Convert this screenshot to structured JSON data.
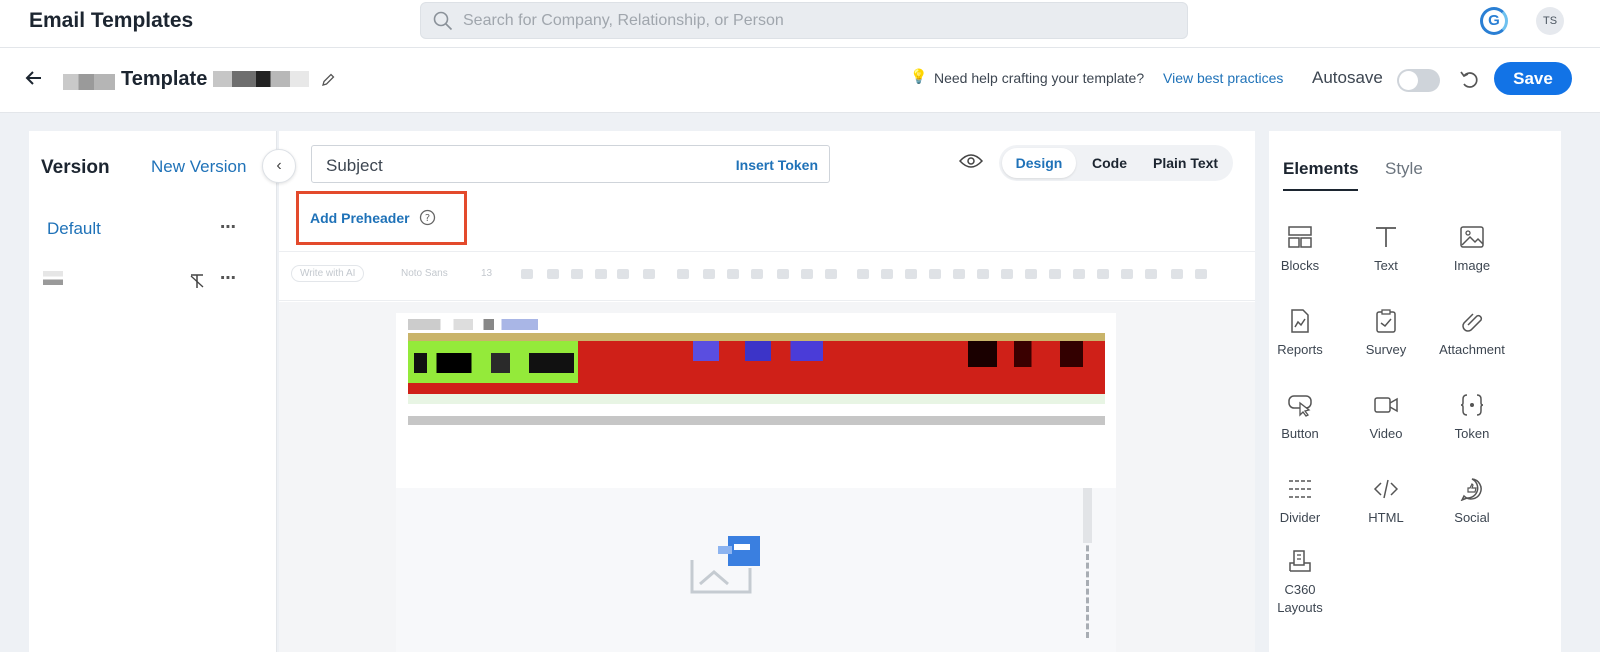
{
  "app": {
    "title": "Email Templates"
  },
  "search": {
    "placeholder": "Search for Company, Relationship, or Person"
  },
  "user": {
    "initials": "TS"
  },
  "template": {
    "name": "Template",
    "help_text": "Need help crafting your template?",
    "help_link": "View best practices",
    "autosave_label": "Autosave",
    "autosave_on": false,
    "save_label": "Save"
  },
  "versions": {
    "title": "Version",
    "new_label": "New Version",
    "items": [
      {
        "label": "Default"
      }
    ]
  },
  "editor": {
    "subject_label": "Subject",
    "insert_token": "Insert Token",
    "preheader_label": "Add Preheader",
    "modes": [
      "Design",
      "Code",
      "Plain Text"
    ],
    "active_mode": "Design",
    "toolbar": {
      "write_ai": "Write with AI",
      "font": "Noto Sans",
      "size": "13"
    }
  },
  "elements_panel": {
    "tabs": [
      "Elements",
      "Style"
    ],
    "active_tab": "Elements",
    "items": [
      {
        "label": "Blocks",
        "icon": "blocks-icon"
      },
      {
        "label": "Text",
        "icon": "text-icon"
      },
      {
        "label": "Image",
        "icon": "image-icon"
      },
      {
        "label": "Reports",
        "icon": "reports-icon"
      },
      {
        "label": "Survey",
        "icon": "survey-icon"
      },
      {
        "label": "Attachment",
        "icon": "attachment-icon"
      },
      {
        "label": "Button",
        "icon": "button-icon"
      },
      {
        "label": "Video",
        "icon": "video-icon"
      },
      {
        "label": "Token",
        "icon": "token-icon"
      },
      {
        "label": "Divider",
        "icon": "divider-icon"
      },
      {
        "label": "HTML",
        "icon": "html-icon"
      },
      {
        "label": "Social",
        "icon": "social-icon"
      },
      {
        "label": "C360 Layouts",
        "icon": "c360-layouts-icon"
      }
    ]
  },
  "colors": {
    "accent": "#1273e6",
    "link": "#1f72b8",
    "highlight": "#e34a2c"
  }
}
